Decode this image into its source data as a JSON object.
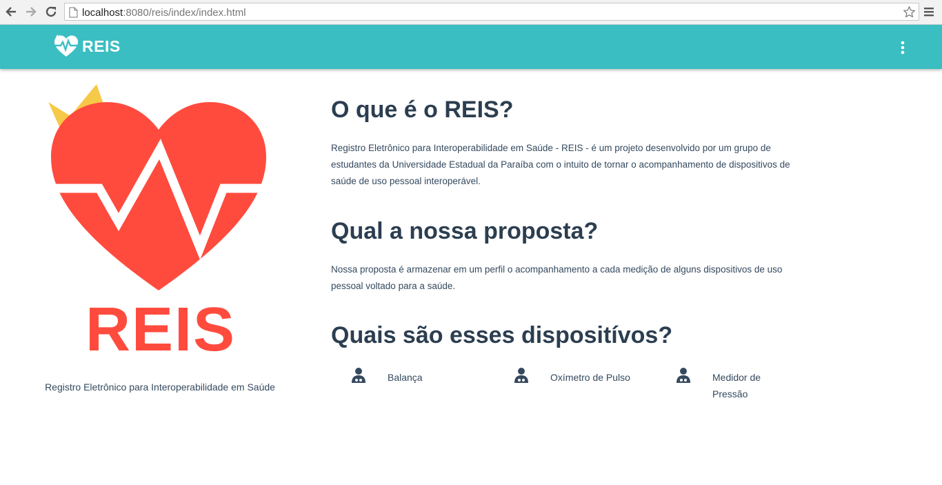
{
  "browser": {
    "url_host": "localhost",
    "url_path": ":8080/reis/index/index.html"
  },
  "navbar": {
    "brand": "REIS"
  },
  "hero": {
    "logo_word": "REIS",
    "tagline": "Registro Eletrônico para Interoperabilidade em Saúde"
  },
  "sections": {
    "about": {
      "title": "O que é o REIS?",
      "text": "Registro Eletrônico para Interoperabilidade em Saúde - REIS - é um projeto desenvolvido por um grupo de estudantes da Universidade Estadual da Paraíba com o intuito de tornar o acompanhamento de dispositivos de saúde de uso pessoal interoperável."
    },
    "proposal": {
      "title": "Qual a nossa proposta?",
      "text": "Nossa proposta é armazenar em um perfil o acompanhamento a cada medição de alguns dispositivos de uso pessoal voltado para a saúde."
    },
    "devices": {
      "title": "Quais são esses dispositívos?",
      "items": [
        {
          "label": "Balança",
          "icon": "user-md-icon"
        },
        {
          "label": "Oxímetro de Pulso",
          "icon": "user-md-icon"
        },
        {
          "label": "Medidor de Pressão",
          "icon": "user-md-icon"
        }
      ]
    }
  },
  "colors": {
    "navbar": "#3bbec2",
    "heart": "#ff4b3e",
    "crown": "#f7c948",
    "text": "#34495e"
  }
}
